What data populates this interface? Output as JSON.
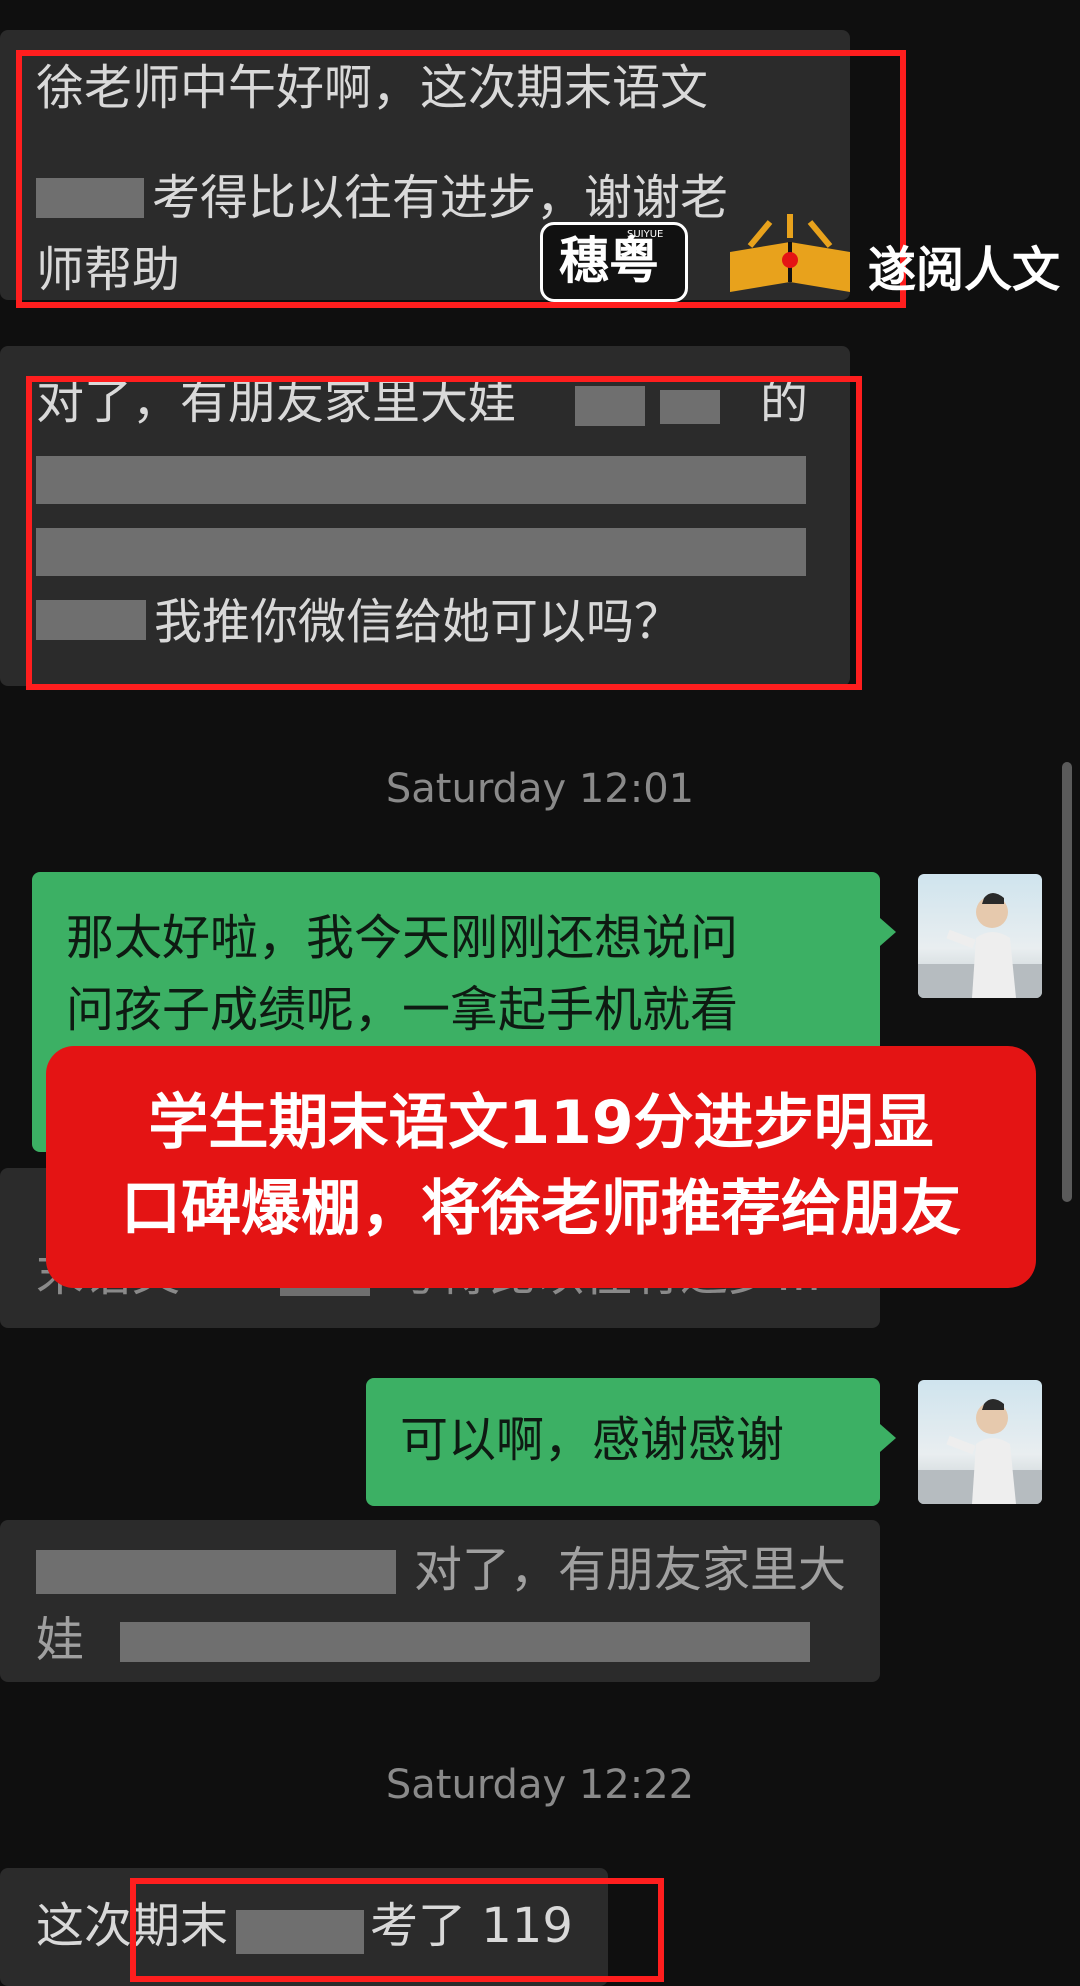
{
  "messages": {
    "m1": {
      "line1": "徐老师中午好啊，这次期末语文",
      "line2": "考得比以往有进步，谢谢老",
      "line3": "师帮助"
    },
    "m2": {
      "line1": "对了，有朋友家里大娃",
      "line1b": "的",
      "line4": "我推你微信给她可以吗？"
    },
    "m3": {
      "line1": "那太好啦，我今天刚刚还想说问",
      "line2": "问孩子成绩呢，一拿起手机就看"
    },
    "m4": {
      "line1": "末语文",
      "line1b": "考得比以往有进步..."
    },
    "m5": {
      "text": "可以啊，感谢感谢"
    },
    "m6": {
      "line1": "对了，有朋友家里大",
      "line2": "娃"
    },
    "m7": {
      "text_a": "这次期末",
      "text_b": "考了 119"
    }
  },
  "timestamps": {
    "t1": "Saturday 12:01",
    "t2": "Saturday 12:22"
  },
  "watermark": {
    "logo_text": "穗粤",
    "logo_small": "SUIYUE",
    "brand": "遂阅人文"
  },
  "overlay": {
    "line1": "学生期末语文119分进步明显",
    "line2": "口碑爆棚，将徐老师推荐给朋友"
  },
  "colors": {
    "background": "#0f0f0f",
    "incoming": "#2b2b2b",
    "outgoing": "#3cb064",
    "highlight": "#ff1e1e",
    "overlay": "#e41414"
  }
}
